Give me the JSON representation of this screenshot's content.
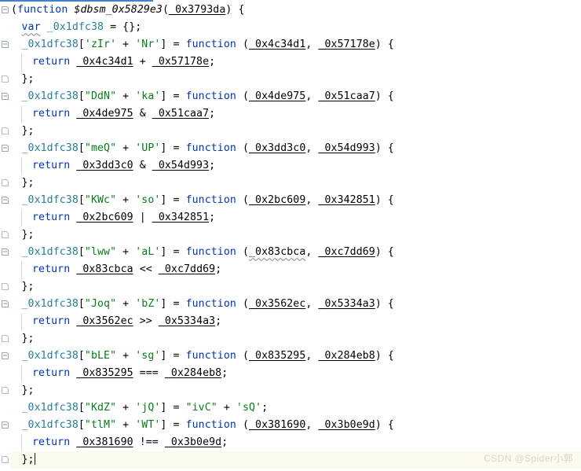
{
  "app": {
    "type": "code-editor",
    "language": "JavaScript",
    "theme": "light",
    "accent_color": "#4083c9",
    "current_line_highlight": "#fcfaed",
    "caret_visible": true
  },
  "colors": {
    "keyword": "#0033b3",
    "string": "#067d17",
    "local_variable": "#267f99",
    "plain_text": "#000000",
    "background": "#ffffff",
    "gutter_guide": "#d8d8d8",
    "fold_marker": "#8a9aa8",
    "watermark": "#d9d4cc"
  },
  "watermark": {
    "text": "CSDN @Spider小郭"
  },
  "editor": {
    "lines": [
      {
        "n": 1,
        "indent": 0,
        "fold": "open",
        "guide": false,
        "current": false,
        "tokens": [
          {
            "t": "(",
            "c": "punct"
          },
          {
            "t": "function",
            "c": "kw"
          },
          {
            "t": " ",
            "c": "plain"
          },
          {
            "t": "$dbsm_0x5829e3",
            "c": "fn-name"
          },
          {
            "t": "(",
            "c": "punct"
          },
          {
            "t": "_0x3793da",
            "c": "param"
          },
          {
            "t": ") {",
            "c": "punct"
          }
        ]
      },
      {
        "n": 2,
        "indent": 1,
        "fold": "none",
        "guide": false,
        "current": false,
        "tokens": [
          {
            "t": "var",
            "c": "kw squiggle"
          },
          {
            "t": " ",
            "c": "plain"
          },
          {
            "t": "_0x1dfc38",
            "c": "local"
          },
          {
            "t": " = {};",
            "c": "punct"
          }
        ]
      },
      {
        "n": 3,
        "indent": 1,
        "fold": "open",
        "guide": false,
        "current": false,
        "tokens": [
          {
            "t": "_0x1dfc38",
            "c": "local"
          },
          {
            "t": "[",
            "c": "punct"
          },
          {
            "t": "'zIr'",
            "c": "str"
          },
          {
            "t": " + ",
            "c": "punct"
          },
          {
            "t": "'Nr'",
            "c": "str"
          },
          {
            "t": "] = ",
            "c": "punct"
          },
          {
            "t": "function",
            "c": "kw"
          },
          {
            "t": " (",
            "c": "punct"
          },
          {
            "t": "_0x4c34d1",
            "c": "param"
          },
          {
            "t": ", ",
            "c": "punct"
          },
          {
            "t": "_0x57178e",
            "c": "param"
          },
          {
            "t": ") {",
            "c": "punct"
          }
        ]
      },
      {
        "n": 4,
        "indent": 2,
        "fold": "none",
        "guide": true,
        "current": false,
        "tokens": [
          {
            "t": "return",
            "c": "kw"
          },
          {
            "t": " ",
            "c": "plain"
          },
          {
            "t": "_0x4c34d1",
            "c": "param"
          },
          {
            "t": " + ",
            "c": "punct"
          },
          {
            "t": "_0x57178e",
            "c": "param"
          },
          {
            "t": ";",
            "c": "punct"
          }
        ]
      },
      {
        "n": 5,
        "indent": 1,
        "fold": "close",
        "guide": false,
        "current": false,
        "tokens": [
          {
            "t": "};",
            "c": "punct"
          }
        ]
      },
      {
        "n": 6,
        "indent": 1,
        "fold": "open",
        "guide": false,
        "current": false,
        "tokens": [
          {
            "t": "_0x1dfc38",
            "c": "local"
          },
          {
            "t": "[",
            "c": "punct"
          },
          {
            "t": "\"DdN\"",
            "c": "str"
          },
          {
            "t": " + ",
            "c": "punct"
          },
          {
            "t": "'ka'",
            "c": "str"
          },
          {
            "t": "] = ",
            "c": "punct"
          },
          {
            "t": "function",
            "c": "kw"
          },
          {
            "t": " (",
            "c": "punct"
          },
          {
            "t": "_0x4de975",
            "c": "param"
          },
          {
            "t": ", ",
            "c": "punct"
          },
          {
            "t": "_0x51caa7",
            "c": "param"
          },
          {
            "t": ") {",
            "c": "punct"
          }
        ]
      },
      {
        "n": 7,
        "indent": 2,
        "fold": "none",
        "guide": true,
        "current": false,
        "tokens": [
          {
            "t": "return",
            "c": "kw"
          },
          {
            "t": " ",
            "c": "plain"
          },
          {
            "t": "_0x4de975",
            "c": "param"
          },
          {
            "t": " & ",
            "c": "punct"
          },
          {
            "t": "_0x51caa7",
            "c": "param"
          },
          {
            "t": ";",
            "c": "punct"
          }
        ]
      },
      {
        "n": 8,
        "indent": 1,
        "fold": "close",
        "guide": false,
        "current": false,
        "tokens": [
          {
            "t": "};",
            "c": "punct"
          }
        ]
      },
      {
        "n": 9,
        "indent": 1,
        "fold": "open",
        "guide": false,
        "current": false,
        "tokens": [
          {
            "t": "_0x1dfc38",
            "c": "local"
          },
          {
            "t": "[",
            "c": "punct"
          },
          {
            "t": "\"meQ\"",
            "c": "str"
          },
          {
            "t": " + ",
            "c": "punct"
          },
          {
            "t": "'UP'",
            "c": "str"
          },
          {
            "t": "] = ",
            "c": "punct"
          },
          {
            "t": "function",
            "c": "kw"
          },
          {
            "t": " (",
            "c": "punct"
          },
          {
            "t": "_0x3dd3c0",
            "c": "param"
          },
          {
            "t": ", ",
            "c": "punct"
          },
          {
            "t": "_0x54d993",
            "c": "param"
          },
          {
            "t": ") {",
            "c": "punct"
          }
        ]
      },
      {
        "n": 10,
        "indent": 2,
        "fold": "none",
        "guide": true,
        "current": false,
        "tokens": [
          {
            "t": "return",
            "c": "kw"
          },
          {
            "t": " ",
            "c": "plain"
          },
          {
            "t": "_0x3dd3c0",
            "c": "param"
          },
          {
            "t": " & ",
            "c": "punct"
          },
          {
            "t": "_0x54d993",
            "c": "param"
          },
          {
            "t": ";",
            "c": "punct"
          }
        ]
      },
      {
        "n": 11,
        "indent": 1,
        "fold": "close",
        "guide": false,
        "current": false,
        "tokens": [
          {
            "t": "};",
            "c": "punct"
          }
        ]
      },
      {
        "n": 12,
        "indent": 1,
        "fold": "open",
        "guide": false,
        "current": false,
        "tokens": [
          {
            "t": "_0x1dfc38",
            "c": "local"
          },
          {
            "t": "[",
            "c": "punct"
          },
          {
            "t": "\"KWc\"",
            "c": "str"
          },
          {
            "t": " + ",
            "c": "punct"
          },
          {
            "t": "'so'",
            "c": "str"
          },
          {
            "t": "] = ",
            "c": "punct"
          },
          {
            "t": "function",
            "c": "kw"
          },
          {
            "t": " (",
            "c": "punct"
          },
          {
            "t": "_0x2bc609",
            "c": "param"
          },
          {
            "t": ", ",
            "c": "punct"
          },
          {
            "t": "_0x342851",
            "c": "param"
          },
          {
            "t": ") {",
            "c": "punct"
          }
        ]
      },
      {
        "n": 13,
        "indent": 2,
        "fold": "none",
        "guide": true,
        "current": false,
        "tokens": [
          {
            "t": "return",
            "c": "kw"
          },
          {
            "t": " ",
            "c": "plain"
          },
          {
            "t": "_0x2bc609",
            "c": "param"
          },
          {
            "t": " | ",
            "c": "punct"
          },
          {
            "t": "_0x342851",
            "c": "param"
          },
          {
            "t": ";",
            "c": "punct"
          }
        ]
      },
      {
        "n": 14,
        "indent": 1,
        "fold": "close",
        "guide": false,
        "current": false,
        "tokens": [
          {
            "t": "};",
            "c": "punct"
          }
        ]
      },
      {
        "n": 15,
        "indent": 1,
        "fold": "open",
        "guide": false,
        "current": false,
        "tokens": [
          {
            "t": "_0x1dfc38",
            "c": "local"
          },
          {
            "t": "[",
            "c": "punct"
          },
          {
            "t": "\"lww\"",
            "c": "str"
          },
          {
            "t": " + ",
            "c": "punct"
          },
          {
            "t": "'aL'",
            "c": "str"
          },
          {
            "t": "] = ",
            "c": "punct"
          },
          {
            "t": "function",
            "c": "kw"
          },
          {
            "t": " (",
            "c": "punct"
          },
          {
            "t": "_0x83cbca",
            "c": "param squiggle"
          },
          {
            "t": ", ",
            "c": "punct"
          },
          {
            "t": "_0xc7dd69",
            "c": "param"
          },
          {
            "t": ") {",
            "c": "punct"
          }
        ]
      },
      {
        "n": 16,
        "indent": 2,
        "fold": "none",
        "guide": true,
        "current": false,
        "tokens": [
          {
            "t": "return",
            "c": "kw"
          },
          {
            "t": " ",
            "c": "plain"
          },
          {
            "t": "_0x83cbca",
            "c": "param"
          },
          {
            "t": " << ",
            "c": "punct"
          },
          {
            "t": "_0xc7dd69",
            "c": "param"
          },
          {
            "t": ";",
            "c": "punct"
          }
        ]
      },
      {
        "n": 17,
        "indent": 1,
        "fold": "close",
        "guide": false,
        "current": false,
        "tokens": [
          {
            "t": "};",
            "c": "punct"
          }
        ]
      },
      {
        "n": 18,
        "indent": 1,
        "fold": "open",
        "guide": false,
        "current": false,
        "tokens": [
          {
            "t": "_0x1dfc38",
            "c": "local"
          },
          {
            "t": "[",
            "c": "punct"
          },
          {
            "t": "\"Joq\"",
            "c": "str"
          },
          {
            "t": " + ",
            "c": "punct"
          },
          {
            "t": "'bZ'",
            "c": "str"
          },
          {
            "t": "] = ",
            "c": "punct"
          },
          {
            "t": "function",
            "c": "kw"
          },
          {
            "t": " (",
            "c": "punct"
          },
          {
            "t": "_0x3562ec",
            "c": "param"
          },
          {
            "t": ", ",
            "c": "punct"
          },
          {
            "t": "_0x5334a3",
            "c": "param"
          },
          {
            "t": ") {",
            "c": "punct"
          }
        ]
      },
      {
        "n": 19,
        "indent": 2,
        "fold": "none",
        "guide": true,
        "current": false,
        "tokens": [
          {
            "t": "return",
            "c": "kw"
          },
          {
            "t": " ",
            "c": "plain"
          },
          {
            "t": "_0x3562ec",
            "c": "param"
          },
          {
            "t": " >> ",
            "c": "punct"
          },
          {
            "t": "_0x5334a3",
            "c": "param"
          },
          {
            "t": ";",
            "c": "punct"
          }
        ]
      },
      {
        "n": 20,
        "indent": 1,
        "fold": "close",
        "guide": false,
        "current": false,
        "tokens": [
          {
            "t": "};",
            "c": "punct"
          }
        ]
      },
      {
        "n": 21,
        "indent": 1,
        "fold": "open",
        "guide": false,
        "current": false,
        "tokens": [
          {
            "t": "_0x1dfc38",
            "c": "local"
          },
          {
            "t": "[",
            "c": "punct"
          },
          {
            "t": "\"bLE\"",
            "c": "str"
          },
          {
            "t": " + ",
            "c": "punct"
          },
          {
            "t": "'sg'",
            "c": "str"
          },
          {
            "t": "] = ",
            "c": "punct"
          },
          {
            "t": "function",
            "c": "kw"
          },
          {
            "t": " (",
            "c": "punct"
          },
          {
            "t": "_0x835295",
            "c": "param"
          },
          {
            "t": ", ",
            "c": "punct"
          },
          {
            "t": "_0x284eb8",
            "c": "param"
          },
          {
            "t": ") {",
            "c": "punct"
          }
        ]
      },
      {
        "n": 22,
        "indent": 2,
        "fold": "none",
        "guide": true,
        "current": false,
        "tokens": [
          {
            "t": "return",
            "c": "kw"
          },
          {
            "t": " ",
            "c": "plain"
          },
          {
            "t": "_0x835295",
            "c": "param"
          },
          {
            "t": " === ",
            "c": "punct"
          },
          {
            "t": "_0x284eb8",
            "c": "param"
          },
          {
            "t": ";",
            "c": "punct"
          }
        ]
      },
      {
        "n": 23,
        "indent": 1,
        "fold": "close",
        "guide": false,
        "current": false,
        "tokens": [
          {
            "t": "};",
            "c": "punct"
          }
        ]
      },
      {
        "n": 24,
        "indent": 1,
        "fold": "none",
        "guide": false,
        "current": false,
        "tokens": [
          {
            "t": "_0x1dfc38",
            "c": "local"
          },
          {
            "t": "[",
            "c": "punct"
          },
          {
            "t": "\"KdZ\"",
            "c": "str"
          },
          {
            "t": " + ",
            "c": "punct"
          },
          {
            "t": "'jQ'",
            "c": "str"
          },
          {
            "t": "] = ",
            "c": "punct"
          },
          {
            "t": "\"ivC\"",
            "c": "str"
          },
          {
            "t": " + ",
            "c": "punct"
          },
          {
            "t": "'sQ'",
            "c": "str"
          },
          {
            "t": ";",
            "c": "punct"
          }
        ]
      },
      {
        "n": 25,
        "indent": 1,
        "fold": "open",
        "guide": false,
        "current": false,
        "tokens": [
          {
            "t": "_0x1dfc38",
            "c": "local"
          },
          {
            "t": "[",
            "c": "punct"
          },
          {
            "t": "\"tlM\"",
            "c": "str"
          },
          {
            "t": " + ",
            "c": "punct"
          },
          {
            "t": "'WT'",
            "c": "str"
          },
          {
            "t": "] = ",
            "c": "punct"
          },
          {
            "t": "function",
            "c": "kw"
          },
          {
            "t": " (",
            "c": "punct"
          },
          {
            "t": "_0x381690",
            "c": "param"
          },
          {
            "t": ", ",
            "c": "punct"
          },
          {
            "t": "_0x3b0e9d",
            "c": "param"
          },
          {
            "t": ") {",
            "c": "punct"
          }
        ]
      },
      {
        "n": 26,
        "indent": 2,
        "fold": "none",
        "guide": true,
        "current": false,
        "tokens": [
          {
            "t": "return",
            "c": "kw"
          },
          {
            "t": " ",
            "c": "plain"
          },
          {
            "t": "_0x381690",
            "c": "param"
          },
          {
            "t": " !== ",
            "c": "punct"
          },
          {
            "t": "_0x3b0e9d",
            "c": "param"
          },
          {
            "t": ";",
            "c": "punct"
          }
        ]
      },
      {
        "n": 27,
        "indent": 1,
        "fold": "close",
        "guide": false,
        "current": true,
        "caret": true,
        "tokens": [
          {
            "t": "};",
            "c": "punct"
          }
        ]
      }
    ]
  }
}
